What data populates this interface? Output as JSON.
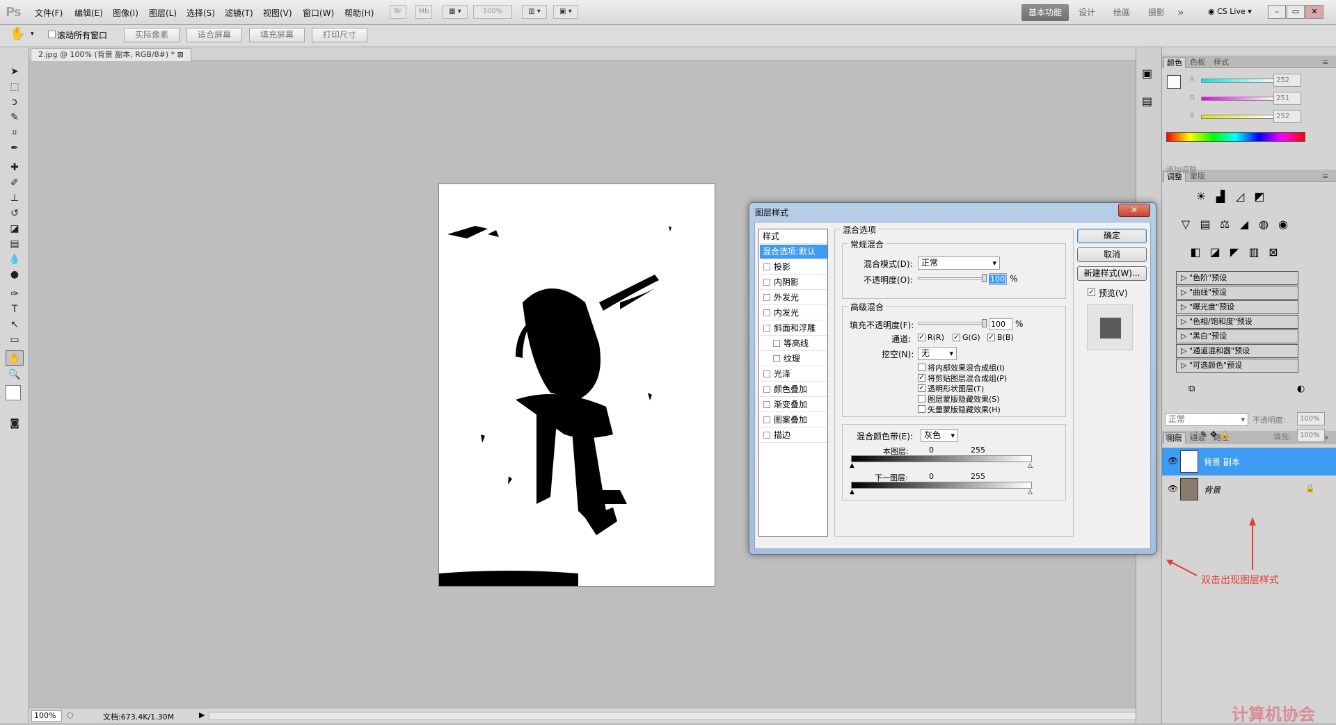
{
  "menubar": {
    "logo": "Ps",
    "items": [
      "文件(F)",
      "编辑(E)",
      "图像(I)",
      "图层(L)",
      "选择(S)",
      "滤镜(T)",
      "视图(V)",
      "窗口(W)",
      "帮助(H)"
    ],
    "btn_br": "Br",
    "btn_mb": "Mb",
    "zoom": "100%",
    "workspaces": [
      "基本功能",
      "设计",
      "绘画",
      "摄影"
    ],
    "more": "»",
    "cslive": "CS Live",
    "win_min": "–",
    "win_restore": "▭",
    "win_close": "✕"
  },
  "options": {
    "scroll_all": "滚动所有窗口",
    "buttons": [
      "实际像素",
      "适合屏幕",
      "填充屏幕",
      "打印尺寸"
    ]
  },
  "document": {
    "tab": "2.jpg @ 100% (背景 副本, RGB/8#) *",
    "tab_close": "⊠"
  },
  "status": {
    "zoom": "100%",
    "doc": "文档:673.4K/1.30M"
  },
  "color_panel": {
    "tabs": [
      "颜色",
      "色板",
      "样式"
    ],
    "channels": [
      {
        "label": "R",
        "value": "252",
        "color": "#00e5e5"
      },
      {
        "label": "G",
        "value": "251",
        "color": "#e500e5"
      },
      {
        "label": "B",
        "value": "252",
        "color": "#e5e500"
      }
    ]
  },
  "adjust_panel": {
    "tabs": [
      "调整",
      "蒙版"
    ],
    "add_label": "添加调整",
    "presets": [
      "\"色阶\"预设",
      "\"曲线\"预设",
      "\"曝光度\"预设",
      "\"色相/饱和度\"预设",
      "\"黑白\"预设",
      "\"通道混和器\"预设",
      "\"可选颜色\"预设"
    ]
  },
  "layers_panel": {
    "tabs": [
      "图层",
      "通道",
      "路径"
    ],
    "blend_mode": "正常",
    "opacity_label": "不透明度:",
    "opacity": "100%",
    "lock_label": "锁定:",
    "fill_label": "填充:",
    "fill": "100%",
    "layers": [
      {
        "name": "背景 副本",
        "selected": true
      },
      {
        "name": "背景",
        "selected": false
      }
    ],
    "annotation": "双击出现图层样式",
    "annotation_color": "#e53935",
    "selected_color": "#3e9bf2"
  },
  "dialog": {
    "title": "图层样式",
    "close": "✕",
    "styles_header": "样式",
    "styles": [
      {
        "label": "混合选项:默认",
        "checkbox": false,
        "selected": true,
        "indent": false
      },
      {
        "label": "投影",
        "checkbox": true,
        "indent": false
      },
      {
        "label": "内阴影",
        "checkbox": true,
        "indent": false
      },
      {
        "label": "外发光",
        "checkbox": true,
        "indent": false
      },
      {
        "label": "内发光",
        "checkbox": true,
        "indent": false
      },
      {
        "label": "斜面和浮雕",
        "checkbox": true,
        "indent": false
      },
      {
        "label": "等高线",
        "checkbox": true,
        "indent": true
      },
      {
        "label": "纹理",
        "checkbox": true,
        "indent": true
      },
      {
        "label": "光泽",
        "checkbox": true,
        "indent": false
      },
      {
        "label": "颜色叠加",
        "checkbox": true,
        "indent": false
      },
      {
        "label": "渐变叠加",
        "checkbox": true,
        "indent": false
      },
      {
        "label": "图案叠加",
        "checkbox": true,
        "indent": false
      },
      {
        "label": "描边",
        "checkbox": true,
        "indent": false
      }
    ],
    "blend_options_title": "混合选项",
    "general_title": "常规混合",
    "blend_mode_label": "混合模式(D):",
    "blend_mode": "正常",
    "opacity_label": "不透明度(O):",
    "opacity": "100",
    "percent": "%",
    "advanced_title": "高级混合",
    "fill_label": "填充不透明度(F):",
    "fill": "100",
    "channels_label": "通道:",
    "ch_r": "R(R)",
    "ch_g": "G(G)",
    "ch_b": "B(B)",
    "knockout_label": "挖空(N):",
    "knockout": "无",
    "checks": [
      {
        "label": "将内部效果混合成组(I)",
        "checked": false
      },
      {
        "label": "将剪贴图层混合成组(P)",
        "checked": true
      },
      {
        "label": "透明形状图层(T)",
        "checked": true
      },
      {
        "label": "图层蒙版隐藏效果(S)",
        "checked": false
      },
      {
        "label": "矢量蒙版隐藏效果(H)",
        "checked": false
      }
    ],
    "blendif_label": "混合颜色带(E):",
    "blendif": "灰色",
    "this_layer": "本图层:",
    "under_layer": "下一图层:",
    "v0": "0",
    "v255": "255",
    "ok": "确定",
    "cancel": "取消",
    "new_style": "新建样式(W)...",
    "preview": "预览(V)"
  },
  "watermark": "计算机协会"
}
